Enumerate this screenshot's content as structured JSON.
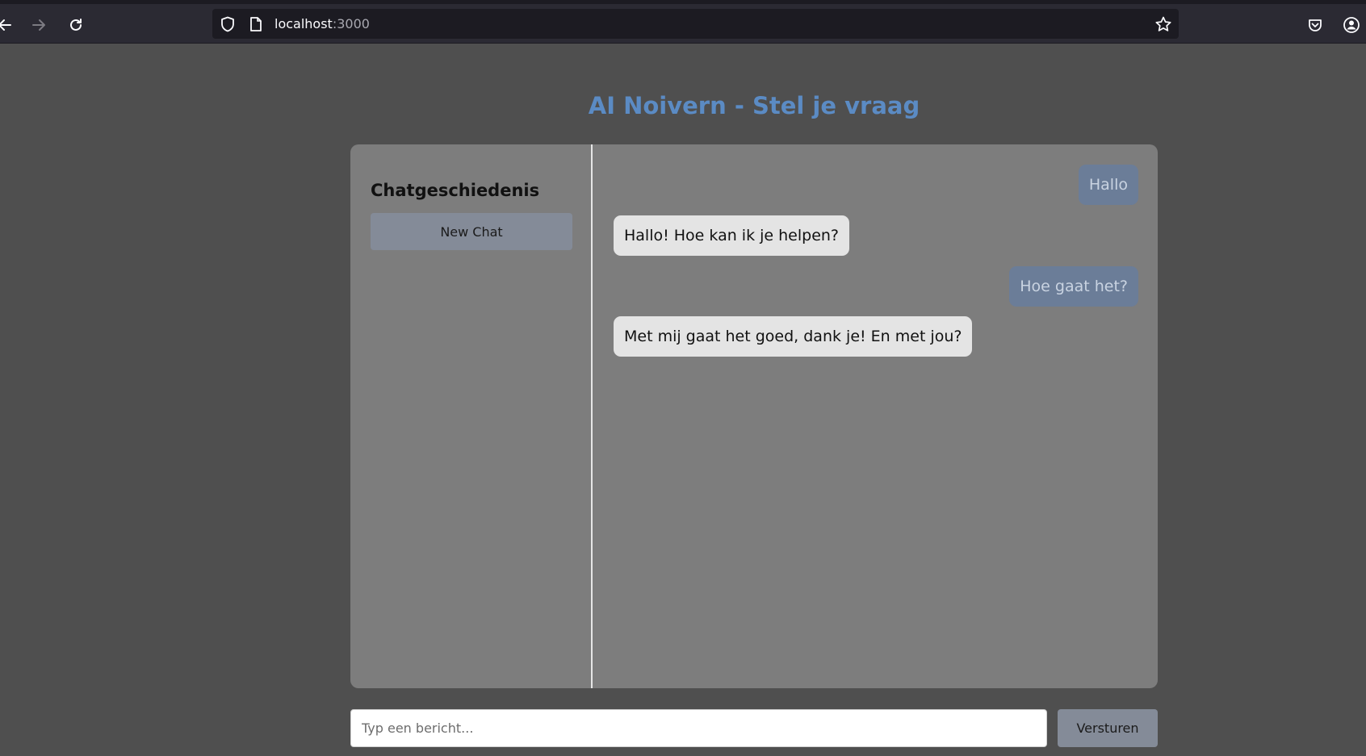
{
  "browser": {
    "url_host": "localhost",
    "url_port": ":3000"
  },
  "page": {
    "title": "AI Noivern - Stel je vraag"
  },
  "sidebar": {
    "title": "Chatgeschiedenis",
    "new_chat_label": "New Chat"
  },
  "messages": [
    {
      "role": "user",
      "text": "Hallo"
    },
    {
      "role": "bot",
      "text": "Hallo! Hoe kan ik je helpen?"
    },
    {
      "role": "user",
      "text": "Hoe gaat het?"
    },
    {
      "role": "bot",
      "text": "Met mij gaat het goed, dank je! En met jou?"
    }
  ],
  "composer": {
    "placeholder": "Typ een bericht...",
    "value": "",
    "send_label": "Versturen"
  },
  "colors": {
    "title_accent": "#5b8bc4",
    "user_bubble": "#6b7d98",
    "bot_bubble": "#e4e4e4",
    "button": "#848b98"
  }
}
